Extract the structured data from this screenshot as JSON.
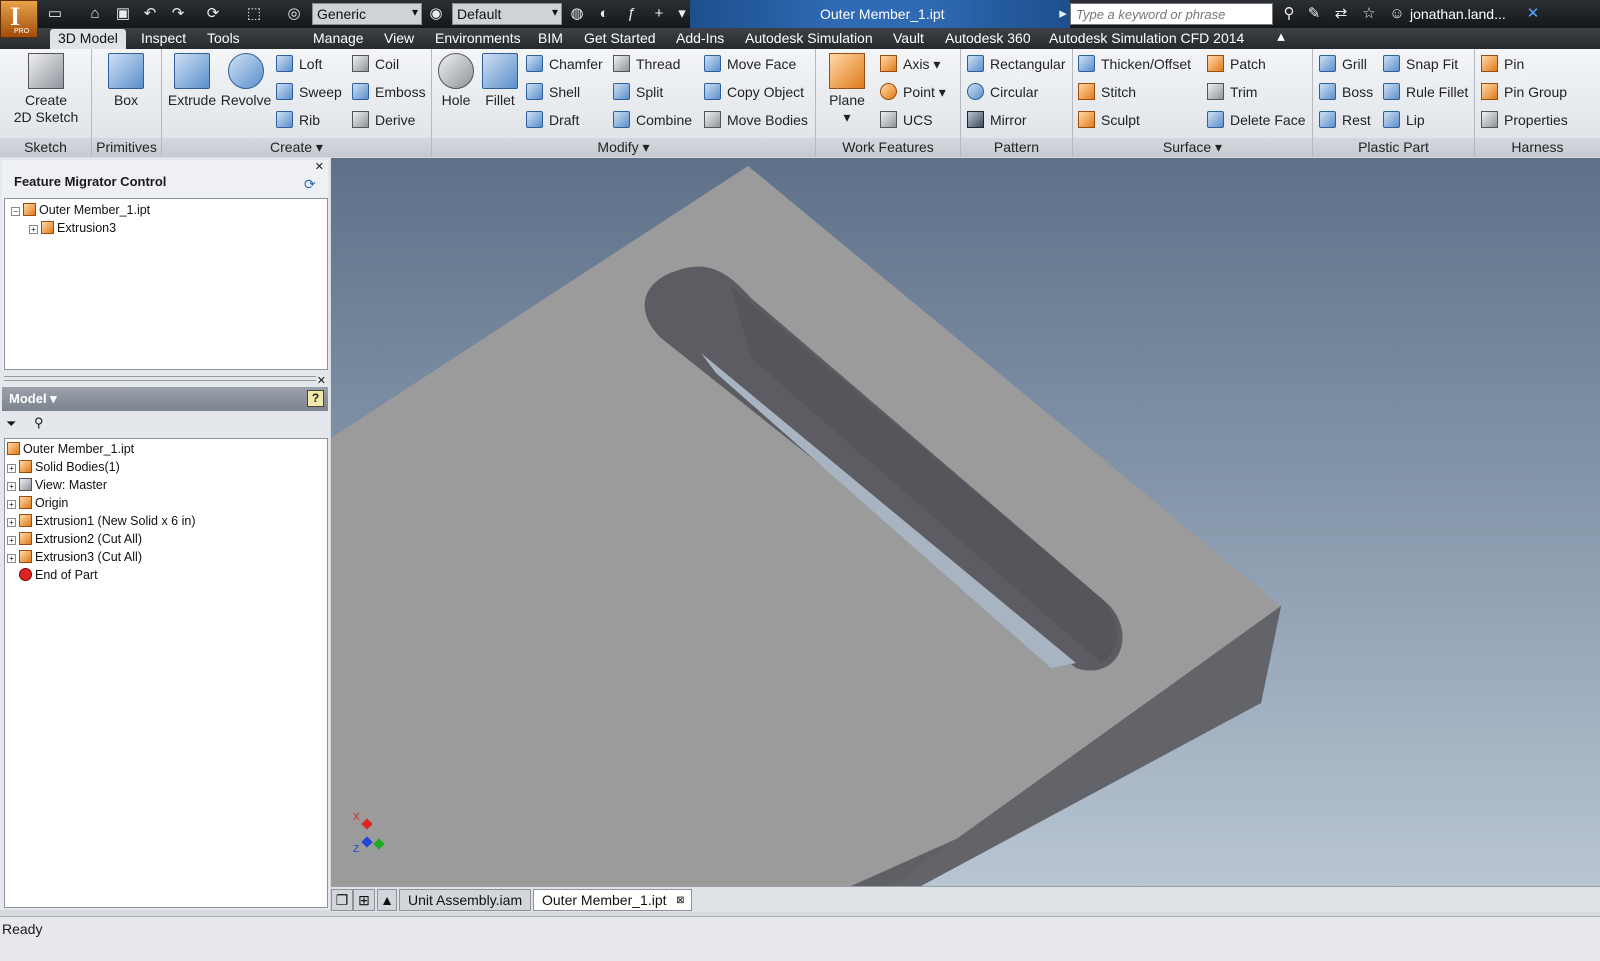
{
  "app": {
    "logo_letter": "I",
    "logo_sub": "PRO",
    "document_title": "Outer Member_1.ipt",
    "search_placeholder": "Type a keyword or phrase",
    "user": "jonathan.land...",
    "material": "Generic",
    "appearance": "Default"
  },
  "tabs": [
    "3D Model",
    "Inspect",
    "Tools",
    "Manage",
    "View",
    "Environments",
    "BIM",
    "Get Started",
    "Add-Ins",
    "Autodesk Simulation",
    "Vault",
    "Autodesk 360",
    "Autodesk Simulation CFD 2014"
  ],
  "ribbon": {
    "sketch": {
      "title": "Sketch",
      "create_line1": "Create",
      "create_line2": "2D Sketch"
    },
    "primitives": {
      "title": "Primitives",
      "box": "Box"
    },
    "create": {
      "title": "Create",
      "extrude": "Extrude",
      "revolve": "Revolve",
      "loft": "Loft",
      "sweep": "Sweep",
      "rib": "Rib",
      "coil": "Coil",
      "emboss": "Emboss",
      "derive": "Derive"
    },
    "modify": {
      "title": "Modify",
      "hole": "Hole",
      "fillet": "Fillet",
      "chamfer": "Chamfer",
      "shell": "Shell",
      "draft": "Draft",
      "thread": "Thread",
      "split": "Split",
      "combine": "Combine",
      "move_face": "Move Face",
      "copy_object": "Copy Object",
      "move_bodies": "Move Bodies"
    },
    "work_features": {
      "title": "Work Features",
      "plane": "Plane",
      "axis": "Axis",
      "point": "Point",
      "ucs": "UCS"
    },
    "pattern": {
      "title": "Pattern",
      "rectangular": "Rectangular",
      "circular": "Circular",
      "mirror": "Mirror"
    },
    "surface": {
      "title": "Surface",
      "thicken": "Thicken/Offset",
      "stitch": "Stitch",
      "sculpt": "Sculpt",
      "patch": "Patch",
      "trim": "Trim",
      "delete_face": "Delete Face"
    },
    "plastic": {
      "title": "Plastic Part",
      "grill": "Grill",
      "boss": "Boss",
      "rest": "Rest",
      "snap_fit": "Snap Fit",
      "rule_fillet": "Rule Fillet",
      "lip": "Lip"
    },
    "harness": {
      "title": "Harness",
      "pin": "Pin",
      "pin_group": "Pin Group",
      "properties": "Properties"
    }
  },
  "migrator": {
    "title": "Feature Migrator Control",
    "root": "Outer Member_1.ipt",
    "child": "Extrusion3"
  },
  "model": {
    "title": "Model",
    "items": [
      "Outer Member_1.ipt",
      "Solid Bodies(1)",
      "View: Master",
      "Origin",
      "Extrusion1 (New Solid x 6 in)",
      "Extrusion2 (Cut All)",
      "Extrusion3 (Cut All)",
      "End of Part"
    ]
  },
  "triad": {
    "x": "X",
    "z": "Z"
  },
  "doc_tabs": [
    "Unit Assembly.iam",
    "Outer Member_1.ipt"
  ],
  "status": "Ready"
}
